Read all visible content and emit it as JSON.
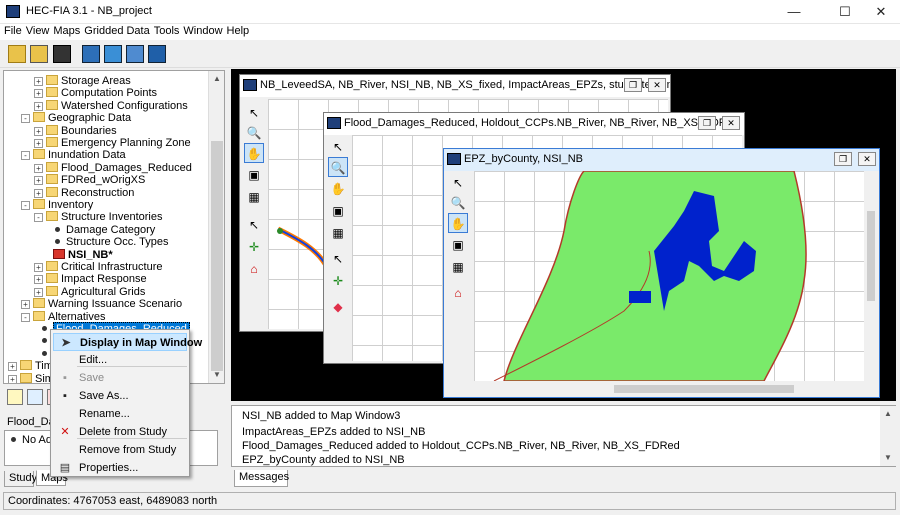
{
  "window": {
    "title": "HEC-FIA 3.1 - NB_project",
    "min": "—",
    "max": "☐",
    "close": "✕"
  },
  "menu": [
    "File",
    "View",
    "Maps",
    "Gridded Data",
    "Tools",
    "Window",
    "Help"
  ],
  "tree": [
    {
      "label": "Storage Areas",
      "indent": 2,
      "pm": "+",
      "kind": "folder"
    },
    {
      "label": "Computation Points",
      "indent": 2,
      "pm": "+",
      "kind": "folder"
    },
    {
      "label": "Watershed Configurations",
      "indent": 2,
      "pm": "+",
      "kind": "folder"
    },
    {
      "label": "Geographic Data",
      "indent": 1,
      "pm": "-",
      "kind": "folder"
    },
    {
      "label": "Boundaries",
      "indent": 2,
      "pm": "+",
      "kind": "folder"
    },
    {
      "label": "Emergency Planning Zone",
      "indent": 2,
      "pm": "+",
      "kind": "folder"
    },
    {
      "label": "Inundation Data",
      "indent": 1,
      "pm": "-",
      "kind": "folder"
    },
    {
      "label": "Flood_Damages_Reduced",
      "indent": 2,
      "pm": "+",
      "kind": "folder"
    },
    {
      "label": "FDRed_wOrigXS",
      "indent": 2,
      "pm": "+",
      "kind": "folder"
    },
    {
      "label": "Reconstruction",
      "indent": 2,
      "pm": "+",
      "kind": "folder"
    },
    {
      "label": "Inventory",
      "indent": 1,
      "pm": "-",
      "kind": "folder"
    },
    {
      "label": "Structure Inventories",
      "indent": 2,
      "pm": "-",
      "kind": "folder"
    },
    {
      "label": "Damage Category",
      "indent": 3,
      "pm": "",
      "kind": "bullet"
    },
    {
      "label": "Structure Occ. Types",
      "indent": 3,
      "pm": "",
      "kind": "bullet"
    },
    {
      "label": "NSI_NB*",
      "indent": 3,
      "pm": "",
      "kind": "inv"
    },
    {
      "label": "Critical Infrastructure",
      "indent": 2,
      "pm": "+",
      "kind": "folder"
    },
    {
      "label": "Impact Response",
      "indent": 2,
      "pm": "+",
      "kind": "folder"
    },
    {
      "label": "Agricultural Grids",
      "indent": 2,
      "pm": "+",
      "kind": "folder"
    },
    {
      "label": "Warning Issuance Scenario",
      "indent": 1,
      "pm": "+",
      "kind": "folder"
    },
    {
      "label": "Alternatives",
      "indent": 1,
      "pm": "-",
      "kind": "folder"
    },
    {
      "label": "Flood_Damages_Reduced",
      "indent": 2,
      "pm": "",
      "kind": "bullet",
      "selected": true
    },
    {
      "label": "",
      "indent": 2,
      "pm": "",
      "kind": "bullet"
    },
    {
      "label": "",
      "indent": 2,
      "pm": "",
      "kind": "bullet"
    },
    {
      "label": "Tim",
      "indent": 0,
      "pm": "+",
      "kind": "folder"
    },
    {
      "label": "Sim",
      "indent": 0,
      "pm": "+",
      "kind": "folder"
    }
  ],
  "lower": {
    "label": "Flood_Dar",
    "item": "No Ad"
  },
  "left_tabs": [
    "Study",
    "Maps"
  ],
  "context_menu": [
    {
      "label": "Display in Map Window",
      "icon": "cursor-icon",
      "state": "highlight"
    },
    {
      "label": "Edit...",
      "icon": "",
      "state": "normal"
    },
    {
      "label": "Save",
      "icon": "save-icon",
      "state": "disabled"
    },
    {
      "label": "Save As...",
      "icon": "save-as-icon",
      "state": "normal"
    },
    {
      "label": "Rename...",
      "icon": "",
      "state": "normal"
    },
    {
      "label": "Delete from Study",
      "icon": "delete-icon",
      "state": "normal"
    },
    {
      "label": "Remove from Study",
      "icon": "",
      "state": "normal"
    },
    {
      "label": "Properties...",
      "icon": "properties-icon",
      "state": "normal"
    }
  ],
  "map_windows": [
    {
      "title": "NB_LeveedSA, NB_River, NSI_NB, NB_XS_fixed, ImpactAreas_EPZs, study_terrain.Study_..."
    },
    {
      "title": "Flood_Damages_Reduced, Holdout_CCPs.NB_River, NB_River, NB_XS_FDRed"
    },
    {
      "title": "EPZ_byCounty, NSI_NB"
    }
  ],
  "log": [
    "NSI_NB added to Map Window3",
    "ImpactAreas_EPZs added to NSI_NB",
    "Flood_Damages_Reduced added to Holdout_CCPs.NB_River, NB_River, NB_XS_FDRed",
    "EPZ_byCounty added to NSI_NB"
  ],
  "log_tab": "Messages",
  "status": "Coordinates: 4767053 east, 6489083 north",
  "colors": {
    "epz_fill": "#7aea6a",
    "river": "#b33a2a",
    "structures": "#0022cc",
    "inundation": "#1040e0",
    "levee": "#ff7a00",
    "select": "#cce8ff"
  }
}
